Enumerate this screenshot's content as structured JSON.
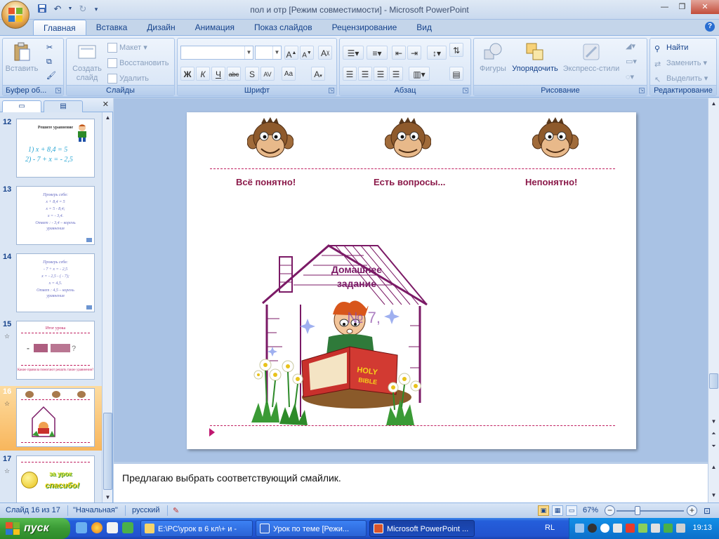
{
  "window": {
    "title": "пол и отр [Режим совместимости] - Microsoft PowerPoint"
  },
  "qat": {
    "icons": [
      "save-icon",
      "undo-icon",
      "redo-icon",
      "customize-icon"
    ]
  },
  "tabs": [
    "Главная",
    "Вставка",
    "Дизайн",
    "Анимация",
    "Показ слайдов",
    "Рецензирование",
    "Вид"
  ],
  "ribbon": {
    "clipboard": {
      "label": "Буфер об...",
      "paste": "Вставить"
    },
    "slides": {
      "label": "Слайды",
      "create": "Создать слайд",
      "layout": "Макет",
      "reset": "Восстановить",
      "delete": "Удалить"
    },
    "font": {
      "label": "Шрифт",
      "font_name": "",
      "font_size": ""
    },
    "paragraph": {
      "label": "Абзац"
    },
    "drawing": {
      "label": "Рисование",
      "shapes": "Фигуры",
      "arrange": "Упорядочить",
      "quick_styles": "Экспресс-стили"
    },
    "editing": {
      "label": "Редактирование",
      "find": "Найти",
      "replace": "Заменить",
      "select": "Выделить"
    }
  },
  "slides_panel": {
    "entries": [
      {
        "num": "12",
        "lines": [
          "Решите уравнение",
          "1)   x + 8,4 = 5",
          "2)   - 7 + x = - 2,5"
        ]
      },
      {
        "num": "13",
        "lines": [
          "Проверь себя:",
          "x + 8,4 = 5",
          "x = 5 - 8,4;",
          "x = - 3,4.",
          "Ответ : - 3,4 – корень",
          "уравнения"
        ]
      },
      {
        "num": "14",
        "lines": [
          "Проверь себя:",
          "- 7 + x = - 2,5",
          "x = - 2,5 - ( - 7);",
          "x = 4,5.",
          "Ответ : 4,5 – корень",
          "уравнения"
        ]
      },
      {
        "num": "15",
        "lines": [
          "Итог урока",
          "Какие правила помогают решать такие уравнения?"
        ]
      },
      {
        "num": "16",
        "lines": []
      },
      {
        "num": "17",
        "lines": [
          "за урок",
          "спасибо!"
        ]
      }
    ]
  },
  "slide": {
    "labels": {
      "ok": "Всё понятно!",
      "questions": "Есть вопросы...",
      "unclear": "Непонятно!"
    },
    "homework_line1": "Домашнее",
    "homework_line2": "задание",
    "homework_number": "№ 7,"
  },
  "notes": {
    "text": "Предлагаю выбрать соответствующий смайлик."
  },
  "status": {
    "slide_info": "Слайд 16 из 17",
    "theme": "\"Начальная\"",
    "language": "русский",
    "zoom": "67%"
  },
  "taskbar": {
    "start": "пуск",
    "tasks": [
      "E:\\PC\\урок в 6 кл\\+ и -",
      "Урок по теме [Режи...",
      "Microsoft PowerPoint ..."
    ],
    "lang": "RL",
    "clock": "19:13"
  }
}
